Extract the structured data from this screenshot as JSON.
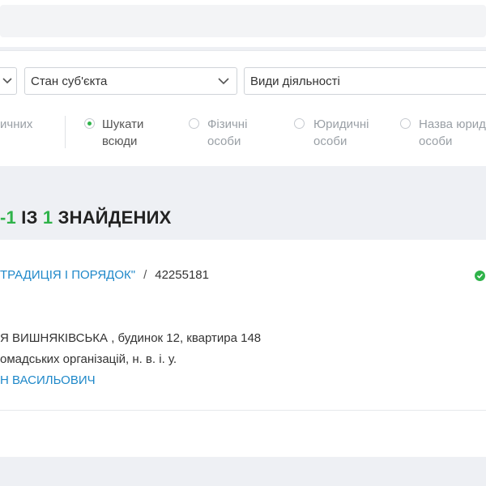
{
  "filters": {
    "subject_state": {
      "label": "Стан суб'єкта"
    },
    "activity_types": {
      "label": "Види діяльності"
    }
  },
  "search_options": {
    "partial_option": {
      "label_line1": "ичних"
    },
    "options": [
      {
        "line1": "Шукати",
        "line2": "всюди",
        "selected": true
      },
      {
        "line1": "Фізичні",
        "line2": "особи",
        "selected": false
      },
      {
        "line1": "Юридичні",
        "line2": "особи",
        "selected": false
      },
      {
        "line1": "Назва юрид",
        "line2": "особи",
        "selected": false
      }
    ]
  },
  "results": {
    "range": "-1",
    "of_word": "ІЗ",
    "total": "1",
    "found_word": "ЗНАЙДЕНИХ"
  },
  "result_card": {
    "org_name": "ТРАДИЦІЯ І ПОРЯДОК\"",
    "separator": "/",
    "code": "42255181",
    "address": "Я ВИШНЯКІВСЬКА , будинок 12, квартира 148",
    "activity": "омадських організацій, н. в. і. у.",
    "head_name": "Н ВАСИЛЬОВИЧ",
    "status_color": "#2fb34a"
  },
  "colors": {
    "accent_green": "#2fb34a",
    "link_blue": "#1e88c9"
  }
}
